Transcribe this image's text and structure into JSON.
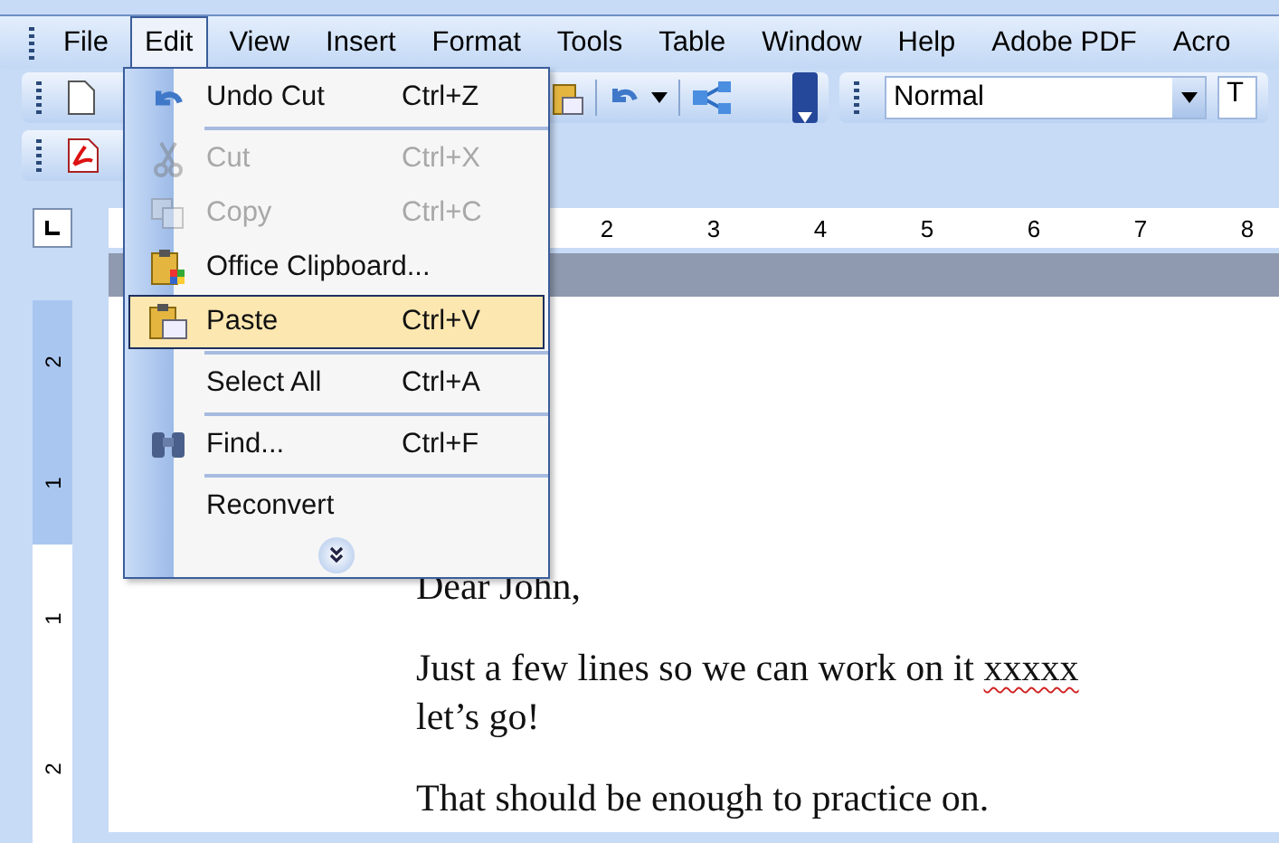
{
  "menu_bar": [
    {
      "label": "File",
      "selected": false
    },
    {
      "label": "Edit",
      "selected": true
    },
    {
      "label": "View",
      "selected": false
    },
    {
      "label": "Insert",
      "selected": false
    },
    {
      "label": "Format",
      "selected": false
    },
    {
      "label": "Tools",
      "selected": false
    },
    {
      "label": "Table",
      "selected": false
    },
    {
      "label": "Window",
      "selected": false
    },
    {
      "label": "Help",
      "selected": false
    },
    {
      "label": "Adobe PDF",
      "selected": false
    },
    {
      "label": "Acro",
      "selected": false
    }
  ],
  "toolbar": {
    "style_field": {
      "value": "Normal"
    },
    "font_field": {
      "value": "T"
    }
  },
  "edit_menu": {
    "items": [
      {
        "label": "Undo Cut",
        "shortcut": "Ctrl+Z",
        "kind": "undo",
        "disabled": false,
        "selected": false,
        "separator": false
      },
      {
        "label": "Cut",
        "shortcut": "Ctrl+X",
        "kind": "cut",
        "disabled": true,
        "selected": false,
        "separator": true
      },
      {
        "label": "Copy",
        "shortcut": "Ctrl+C",
        "kind": "copy",
        "disabled": true,
        "selected": false,
        "separator": false
      },
      {
        "label": "Office Clipboard...",
        "kind": "clipboard",
        "disabled": false,
        "selected": false,
        "separator": false
      },
      {
        "label": "Paste",
        "shortcut": "Ctrl+V",
        "kind": "paste",
        "disabled": false,
        "selected": true,
        "separator": false
      },
      {
        "label": "Select All",
        "shortcut": "Ctrl+A",
        "kind": "plain",
        "disabled": false,
        "selected": false,
        "separator": true
      },
      {
        "label": "Find...",
        "shortcut": "Ctrl+F",
        "kind": "find",
        "disabled": false,
        "selected": false,
        "separator": true
      },
      {
        "label": "Reconvert",
        "kind": "plain",
        "disabled": false,
        "selected": false,
        "separator": true
      }
    ]
  },
  "ruler": {
    "numbers": [
      "2",
      "3",
      "4",
      "5",
      "6",
      "7",
      "8"
    ]
  },
  "vertical_ruler": {
    "numbers": [
      "2",
      "1",
      "1",
      "2"
    ]
  },
  "document": {
    "paragraphs": [
      {
        "lines": [
          {
            "text": "Dear John,"
          }
        ]
      },
      {
        "lines": [
          {
            "text": "Just a few lines so we can work on it ",
            "misspelled": "xxxxx"
          },
          {
            "text": "let’s go!"
          }
        ]
      },
      {
        "lines": [
          {
            "text": "That should be enough to practice on."
          }
        ]
      }
    ]
  }
}
